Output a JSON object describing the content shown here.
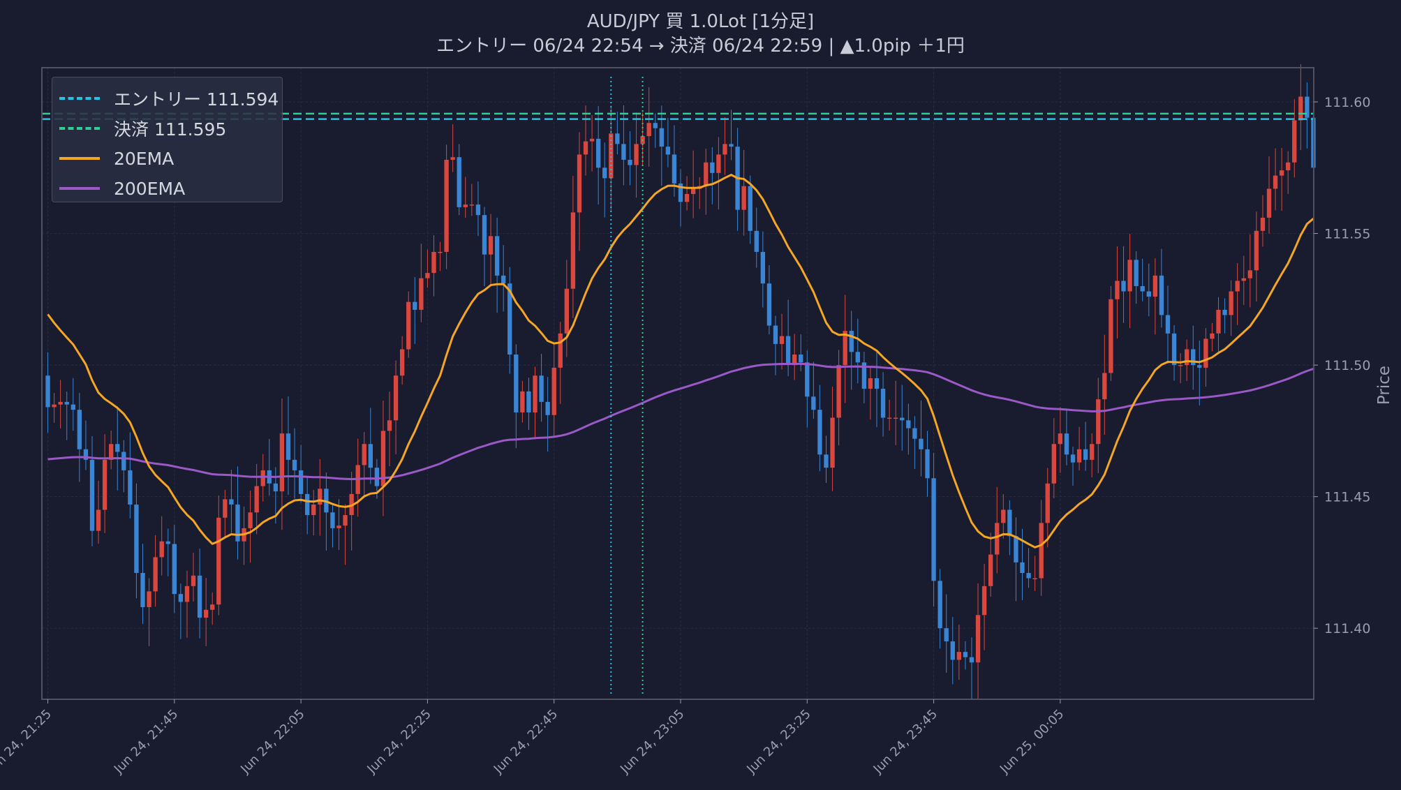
{
  "title_line1": "AUD/JPY 買 1.0Lot [1分足]",
  "title_line2": "エントリー 06/24 22:54 → 決済 06/24 22:59 | ▲1.0pip ＋1円",
  "legend": {
    "entry": "エントリー 111.594",
    "exit": "決済 111.595",
    "ema20": "20EMA",
    "ema200": "200EMA"
  },
  "colors": {
    "background": "#191b2e",
    "up_candle": "#d9473f",
    "down_candle": "#3a86d4",
    "entry_line": "#22c4e8",
    "exit_line": "#2fcf95",
    "ema20": "#f5a623",
    "ema200": "#9b59c7",
    "grid": "#2b2e44",
    "axis_text": "#9a9eae"
  },
  "chart_data": {
    "type": "candlestick",
    "symbol": "AUD/JPY",
    "ylabel": "Price",
    "ylim": [
      111.373,
      111.613
    ],
    "yticks": [
      111.4,
      111.45,
      111.5,
      111.55,
      111.6
    ],
    "ytick_labels": [
      "111.40",
      "111.45",
      "111.50",
      "111.55",
      "111.60"
    ],
    "xtick_labels": [
      "Jun 24, 21:25",
      "Jun 24, 21:45",
      "Jun 24, 22:05",
      "Jun 24, 22:25",
      "Jun 24, 22:45",
      "Jun 24, 23:05",
      "Jun 24, 23:25",
      "Jun 24, 23:45",
      "Jun 25, 00:05"
    ],
    "entry_price": 111.594,
    "exit_price": 111.595,
    "entry_time": "06/24 22:54",
    "exit_time": "06/24 22:59",
    "closes": [
      111.484,
      111.485,
      111.486,
      111.485,
      111.483,
      111.468,
      111.464,
      111.437,
      111.445,
      111.464,
      111.47,
      111.467,
      111.46,
      111.447,
      111.421,
      111.408,
      111.414,
      111.427,
      111.433,
      111.432,
      111.413,
      111.41,
      111.416,
      111.42,
      111.404,
      111.407,
      111.409,
      111.442,
      111.449,
      111.447,
      111.433,
      111.438,
      111.444,
      111.454,
      111.46,
      111.455,
      111.452,
      111.474,
      111.464,
      111.46,
      111.451,
      111.443,
      111.447,
      111.453,
      111.444,
      111.438,
      111.439,
      111.443,
      111.451,
      111.462,
      111.47,
      111.461,
      111.454,
      111.475,
      111.479,
      111.496,
      111.506,
      111.524,
      111.521,
      111.533,
      111.535,
      111.543,
      111.543,
      111.578,
      111.579,
      111.56,
      111.561,
      111.561,
      111.557,
      111.542,
      111.549,
      111.534,
      111.531,
      111.504,
      111.482,
      111.49,
      111.482,
      111.496,
      111.486,
      111.481,
      111.499,
      111.512,
      111.529,
      111.558,
      111.58,
      111.585,
      111.586,
      111.575,
      111.571,
      111.588,
      111.584,
      111.578,
      111.576,
      111.584,
      111.587,
      111.592,
      111.59,
      111.583,
      111.58,
      111.569,
      111.562,
      111.565,
      111.567,
      111.568,
      111.577,
      111.573,
      111.58,
      111.584,
      111.583,
      111.559,
      111.568,
      111.551,
      111.543,
      111.531,
      111.515,
      111.508,
      111.511,
      111.5,
      111.504,
      111.501,
      111.488,
      111.483,
      111.466,
      111.461,
      111.48,
      111.5,
      111.513,
      111.505,
      111.501,
      111.491,
      111.495,
      111.491,
      111.48,
      111.48,
      111.48,
      111.479,
      111.476,
      111.472,
      111.468,
      111.457,
      111.418,
      111.4,
      111.395,
      111.388,
      111.391,
      111.389,
      111.387,
      111.405,
      111.416,
      111.428,
      111.44,
      111.445,
      111.435,
      111.425,
      111.421,
      111.419,
      111.419,
      111.44,
      111.455,
      111.47,
      111.474,
      111.466,
      111.463,
      111.468,
      111.464,
      111.47,
      111.487,
      111.497,
      111.525,
      111.532,
      111.528,
      111.54,
      111.53,
      111.528,
      111.526,
      111.534,
      111.519,
      111.512,
      111.5,
      111.5,
      111.506,
      111.5,
      111.499,
      111.51,
      111.512,
      111.521,
      111.519,
      111.528,
      111.532,
      111.533,
      111.536,
      111.551,
      111.556,
      111.567,
      111.572,
      111.574,
      111.577,
      111.593,
      111.602,
      111.594,
      111.575
    ]
  }
}
